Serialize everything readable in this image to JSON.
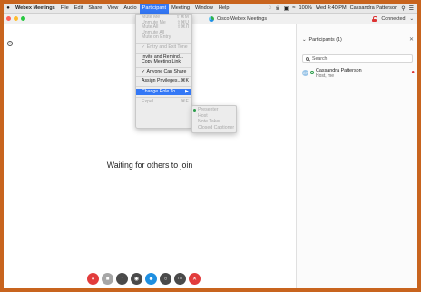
{
  "menubar": {
    "app_name": "Webex Meetings",
    "items": [
      "File",
      "Edit",
      "Share",
      "View",
      "Audio",
      "Participant",
      "Meeting",
      "Window",
      "Help"
    ],
    "active_item": "Participant",
    "battery": "100%",
    "datetime": "Wed 4:40 PM",
    "user": "Cassandra Patterson"
  },
  "window": {
    "title": "Cisco Webex Meetings",
    "status": "Connected"
  },
  "participant_menu": {
    "items": [
      {
        "label": "Mute Me",
        "shortcut": "⇧⌘M",
        "enabled": false
      },
      {
        "label": "Unmute Me",
        "shortcut": "⇧⌘U",
        "enabled": false
      },
      {
        "label": "Mute All",
        "shortcut": "⇧⌘Л",
        "enabled": false
      },
      {
        "label": "Unmute All",
        "shortcut": "",
        "enabled": false
      },
      {
        "label": "Mute on Entry",
        "shortcut": "",
        "enabled": false
      },
      {
        "label": "✓ Entry and Exit Tone",
        "shortcut": "",
        "enabled": false
      },
      {
        "label": "Invite and Remind...",
        "shortcut": "",
        "enabled": true
      },
      {
        "label": "Copy Meeting Link",
        "shortcut": "",
        "enabled": true
      },
      {
        "label": "✓ Anyone Can Share",
        "shortcut": "",
        "enabled": true
      },
      {
        "label": "Assign Privileges...",
        "shortcut": "⌘K",
        "enabled": true
      },
      {
        "label": "Change Role To",
        "shortcut": "▶",
        "enabled": true,
        "highlighted": true
      },
      {
        "label": "Expel",
        "shortcut": "⌘E",
        "enabled": false
      }
    ]
  },
  "role_submenu": {
    "items": [
      "Presenter",
      "Host",
      "Note Taker",
      "Closed Captioner"
    ]
  },
  "stage": {
    "message": "Waiting for others to join"
  },
  "participants": {
    "header": "Participants (1)",
    "search_placeholder": "Search",
    "list": [
      {
        "name": "Cassandra Patterson",
        "role": "Host, me",
        "initials": "CP"
      }
    ]
  },
  "colors": {
    "accent": "#3478f6",
    "border": "#c8641e",
    "end_button": "#e23c3c",
    "video_button": "#1e8fe1"
  }
}
